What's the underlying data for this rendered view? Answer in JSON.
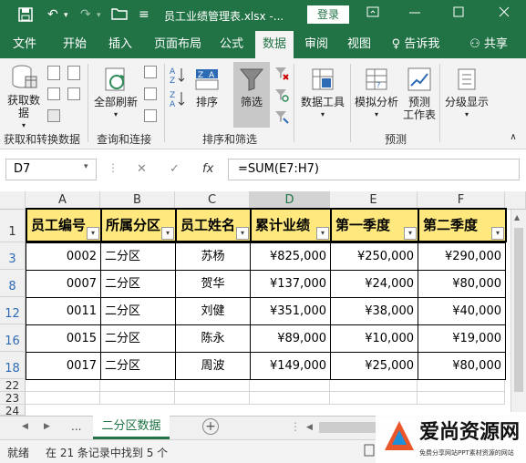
{
  "titlebar": {
    "save_icon": "save-icon",
    "undo_icon": "undo-icon",
    "redo_icon": "redo-icon",
    "open_icon": "open-folder-icon",
    "customize_glyph": "≡",
    "title": "员工业绩管理表.xlsx  -...",
    "login_label": "登录",
    "ribbon_toggle_icon": "ribbon-display-icon",
    "minimize_icon": "minimize-icon",
    "maximize_icon": "maximize-icon",
    "close_icon": "close-icon"
  },
  "tabs": [
    "文件",
    "开始",
    "插入",
    "页面布局",
    "公式",
    "数据",
    "审阅",
    "视图"
  ],
  "active_tab": "数据",
  "tell_me": "告诉我",
  "share": "共享",
  "ribbon": {
    "get_data": "获取数\n据",
    "refresh_all": "全部刷新",
    "sort": "排序",
    "filter": "筛选",
    "data_tools": "数据工具",
    "what_if": "模拟分析",
    "forecast_sheet": "预测\n工作表",
    "outline": "分级显示",
    "groups": [
      "获取和转换数据",
      "查询和连接",
      "排序和筛选",
      "预测"
    ]
  },
  "formula_bar": {
    "name_box": "D7",
    "cancel_glyph": "✕",
    "enter_glyph": "✓",
    "fx": "fx",
    "formula": "=SUM(E7:H7)"
  },
  "columns": [
    "A",
    "B",
    "C",
    "D",
    "E",
    "F"
  ],
  "selected_column": "D",
  "rows": [
    {
      "n": "1",
      "filtered": false
    },
    {
      "n": "3",
      "filtered": true
    },
    {
      "n": "8",
      "filtered": true
    },
    {
      "n": "12",
      "filtered": true
    },
    {
      "n": "16",
      "filtered": true
    },
    {
      "n": "18",
      "filtered": true
    },
    {
      "n": "22",
      "filtered": false
    },
    {
      "n": "23",
      "filtered": false
    },
    {
      "n": "24",
      "filtered": false
    }
  ],
  "table": {
    "headers": [
      "员工编号",
      "所属分区",
      "员工姓名",
      "累计业绩",
      "第一季度",
      "第二季度"
    ],
    "records": [
      [
        "0002",
        "二分区",
        "苏杨",
        "¥825,000",
        "¥250,000",
        "¥290,000"
      ],
      [
        "0007",
        "二分区",
        "贺华",
        "¥137,000",
        "¥24,000",
        "¥80,000"
      ],
      [
        "0011",
        "二分区",
        "刘健",
        "¥351,000",
        "¥38,000",
        "¥40,000"
      ],
      [
        "0015",
        "二分区",
        "陈永",
        "¥89,000",
        "¥10,000",
        "¥19,000"
      ],
      [
        "0017",
        "二分区",
        "周波",
        "¥149,000",
        "¥25,000",
        "¥80,000"
      ]
    ]
  },
  "sheet_tabs": {
    "more": "...",
    "active": "二分区数据",
    "add": "+"
  },
  "status": {
    "mode": "就绪",
    "message": "在 21 条记录中找到 5 个"
  },
  "watermark": {
    "brand": "爱尚资源网",
    "tagline": "免费分享网站PPT素材资源的网站"
  }
}
